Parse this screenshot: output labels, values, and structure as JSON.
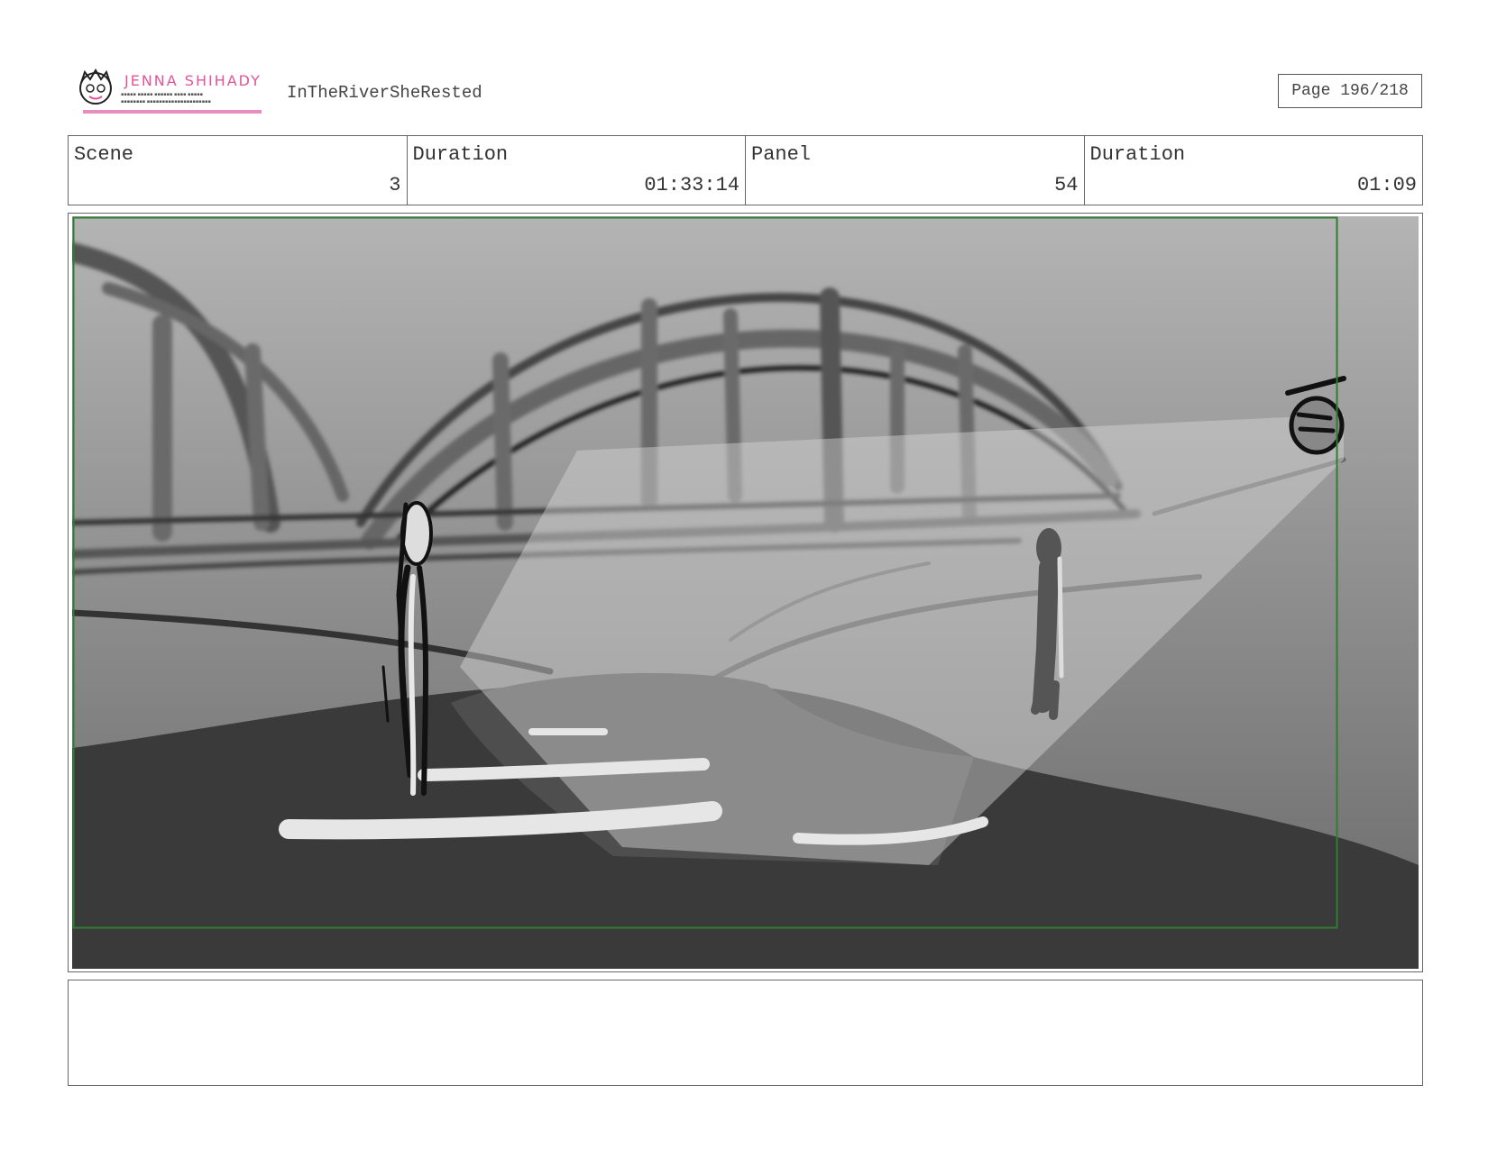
{
  "header": {
    "logo": {
      "name": "JENNA SHIHADY"
    },
    "project_title": "InTheRiverSheRested",
    "page_label": "Page 196/218"
  },
  "info": {
    "scene_label": "Scene",
    "scene_value": "3",
    "scene_duration_label": "Duration",
    "scene_duration_value": "01:33:14",
    "panel_label": "Panel",
    "panel_value": "54",
    "panel_duration_label": "Duration",
    "panel_duration_value": "01:09"
  },
  "colors": {
    "logo_pink": "#e0559a",
    "safe_frame_green": "#2e7d32"
  },
  "notes": ""
}
